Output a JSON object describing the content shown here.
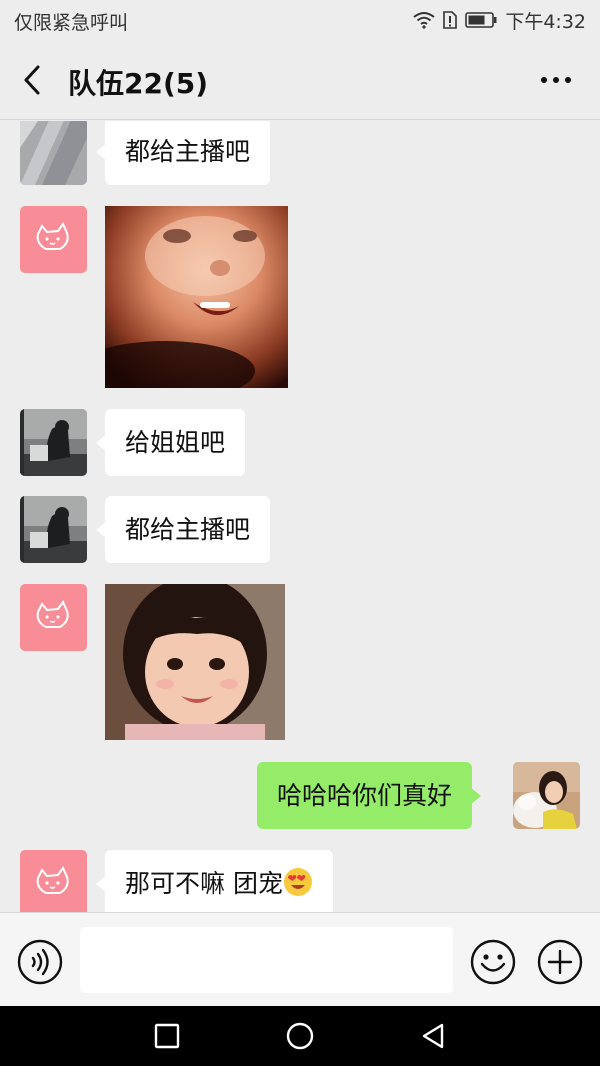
{
  "status_bar": {
    "carrier": "仅限紧急呼叫",
    "time": "下午4:32"
  },
  "header": {
    "title": "队伍22(5)"
  },
  "messages": [
    {
      "side": "left",
      "type": "text",
      "avatar": "gray-geometric-avatar",
      "text": "都给主播吧"
    },
    {
      "side": "left",
      "type": "image",
      "avatar": "pink-cat-avatar",
      "image": "child-face-closeup-photo"
    },
    {
      "side": "left",
      "type": "text",
      "avatar": "dark-photo-avatar",
      "text": "给姐姐吧"
    },
    {
      "side": "left",
      "type": "text",
      "avatar": "dark-photo-avatar",
      "text": "都给主播吧"
    },
    {
      "side": "left",
      "type": "image",
      "avatar": "pink-cat-avatar",
      "image": "smiling-girl-photo"
    },
    {
      "side": "right",
      "type": "text",
      "avatar": "woman-with-dog-avatar",
      "text": "哈哈哈你们真好"
    },
    {
      "side": "left",
      "type": "text",
      "avatar": "pink-cat-avatar",
      "text": "那可不嘛 团宠",
      "emoji": "heart-eyes-emoji"
    }
  ],
  "input": {
    "value": "",
    "placeholder": ""
  },
  "colors": {
    "background": "#ededed",
    "self_bubble": "#95ec69",
    "other_bubble": "#ffffff",
    "pink_avatar": "#f88d98"
  },
  "icons": [
    "back-icon",
    "more-icon",
    "voice-icon",
    "emoji-icon",
    "plus-icon",
    "nav-recent-icon",
    "nav-home-icon",
    "nav-back-icon"
  ]
}
